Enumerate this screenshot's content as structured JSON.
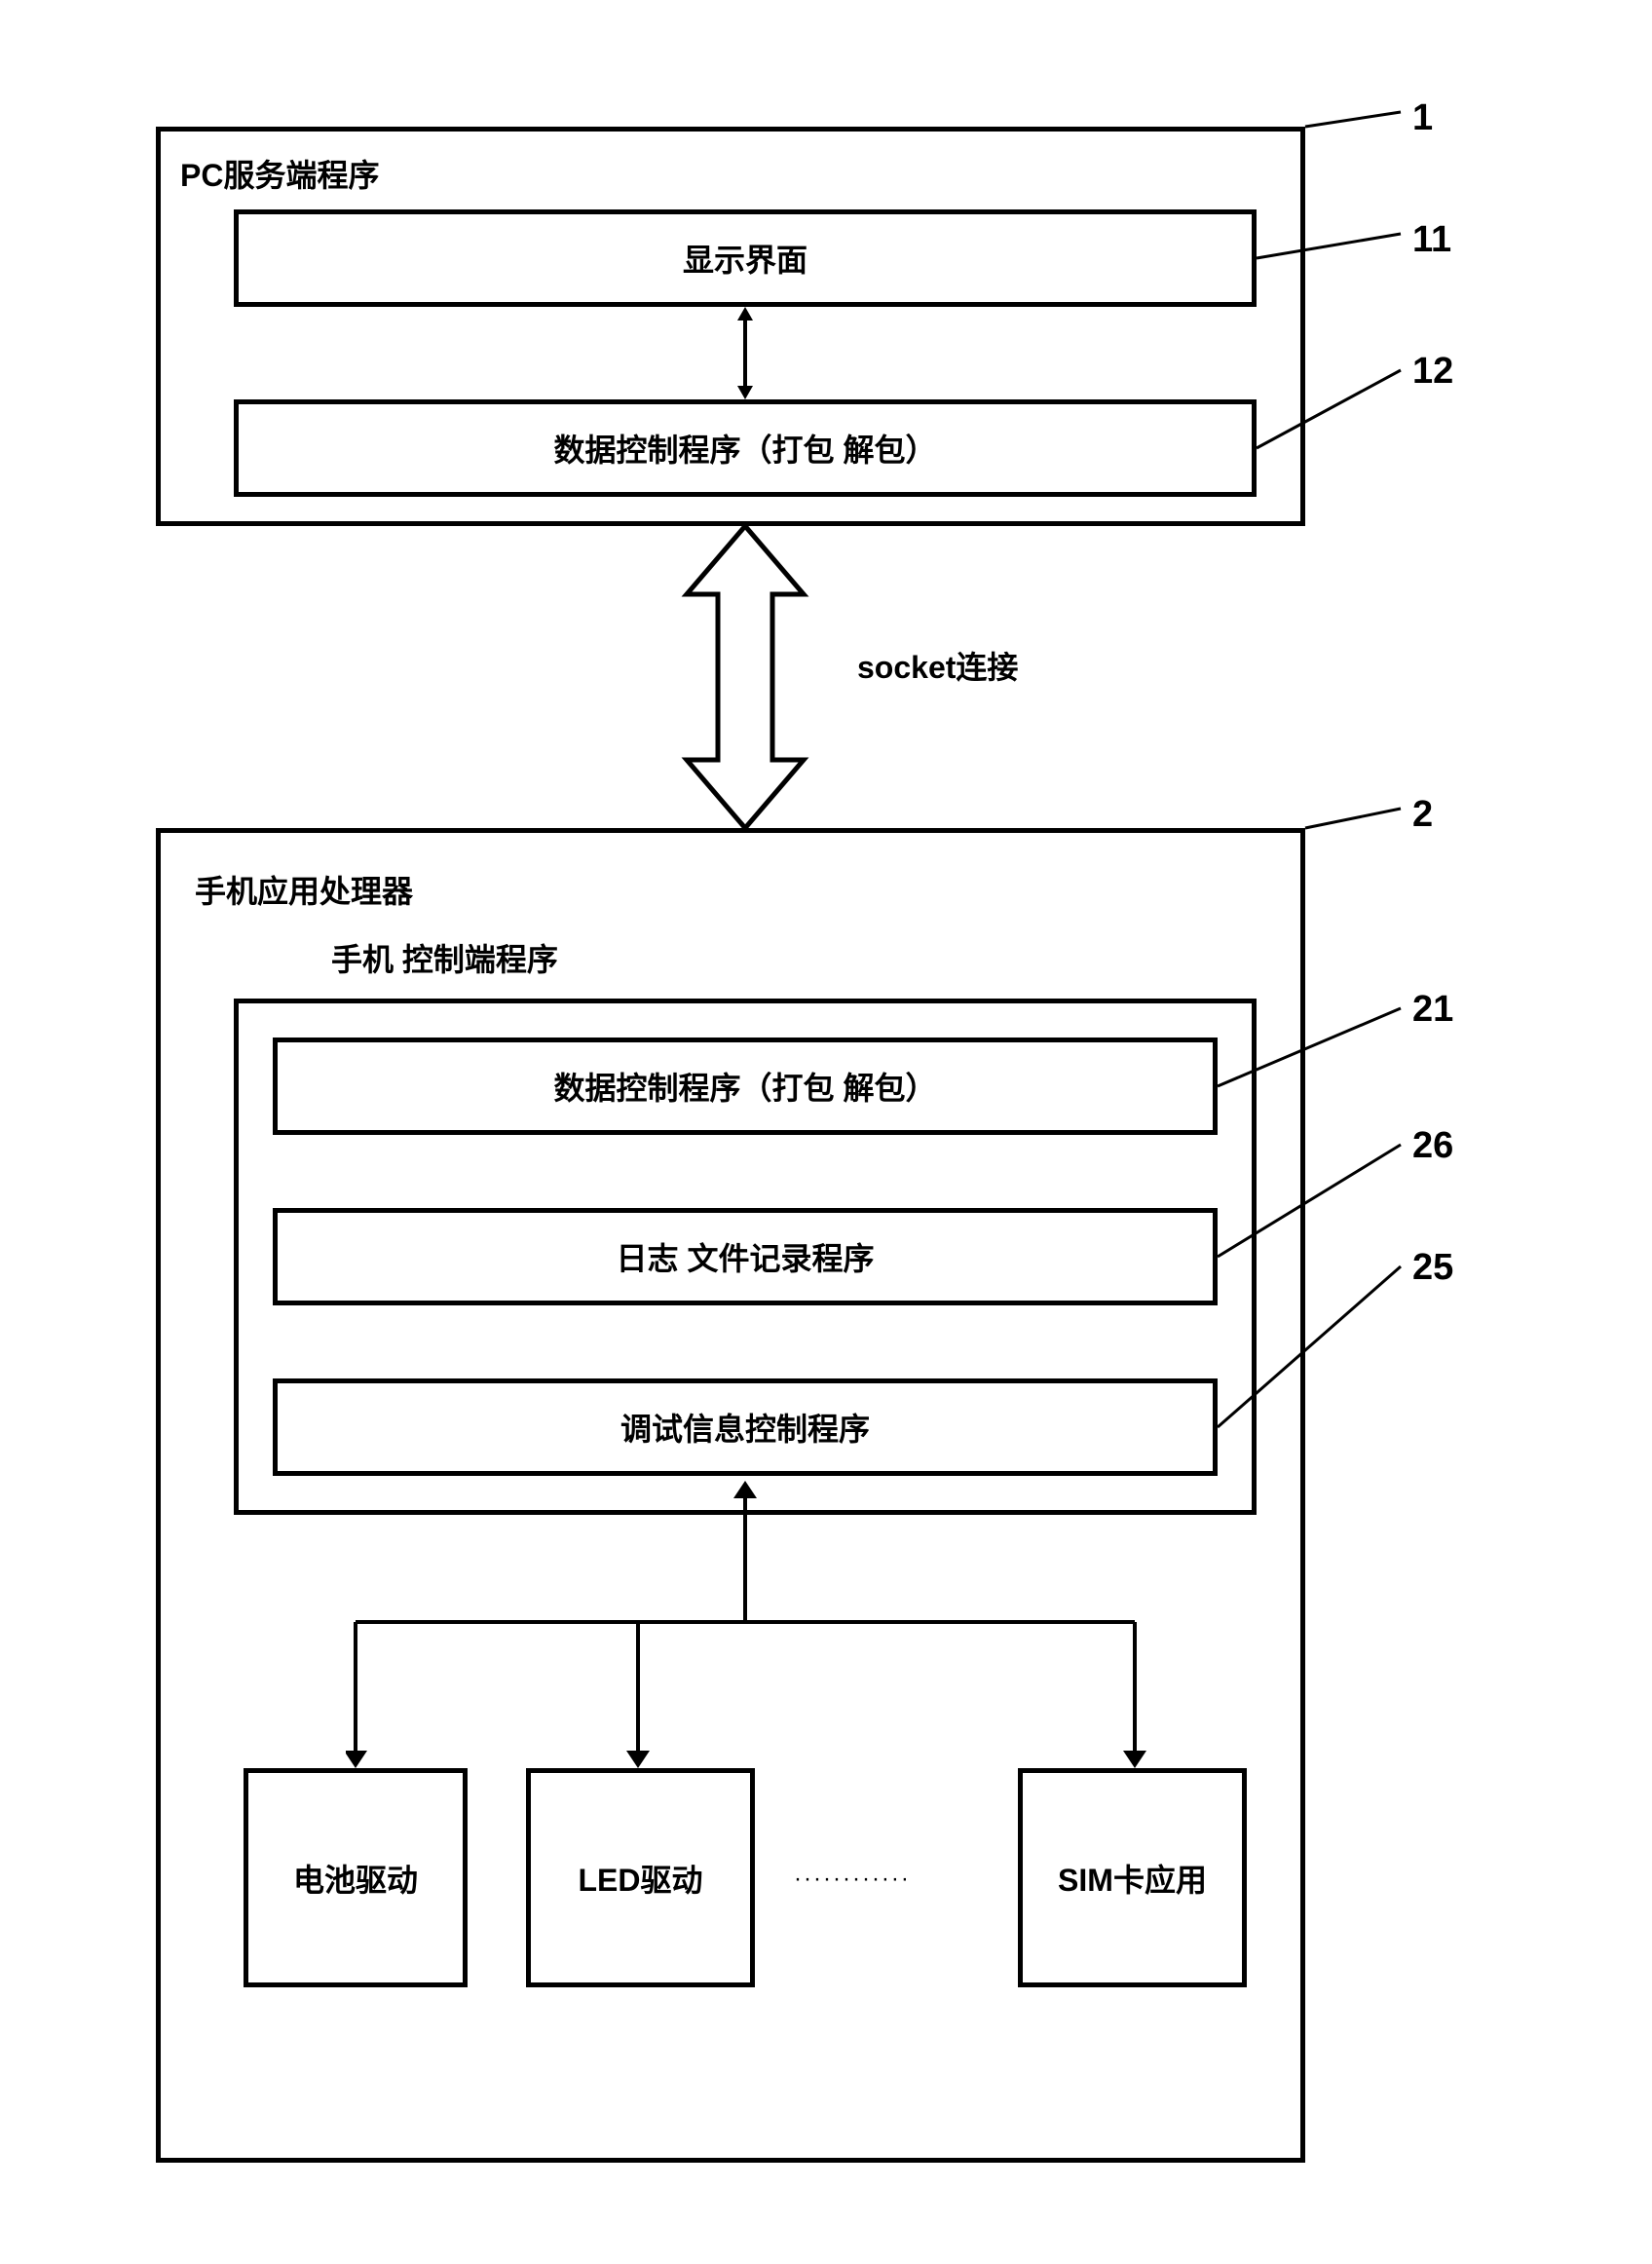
{
  "pc_section": {
    "title": "PC服务端程序",
    "display_box": "显示界面",
    "data_control": "数据控制程序（打包 解包）"
  },
  "connection": {
    "socket_label": "socket连接"
  },
  "phone_section": {
    "title": "手机应用处理器",
    "control_title": "手机 控制端程序",
    "data_control": "数据控制程序（打包 解包）",
    "log_program": "日志 文件记录程序",
    "debug_program": "调试信息控制程序"
  },
  "drivers": {
    "battery": "电池驱动",
    "led": "LED驱动",
    "sim": "SIM卡应用",
    "dots": "············"
  },
  "labels": {
    "num1": "1",
    "num11": "11",
    "num12": "12",
    "num2": "2",
    "num21": "21",
    "num26": "26",
    "num25": "25"
  }
}
